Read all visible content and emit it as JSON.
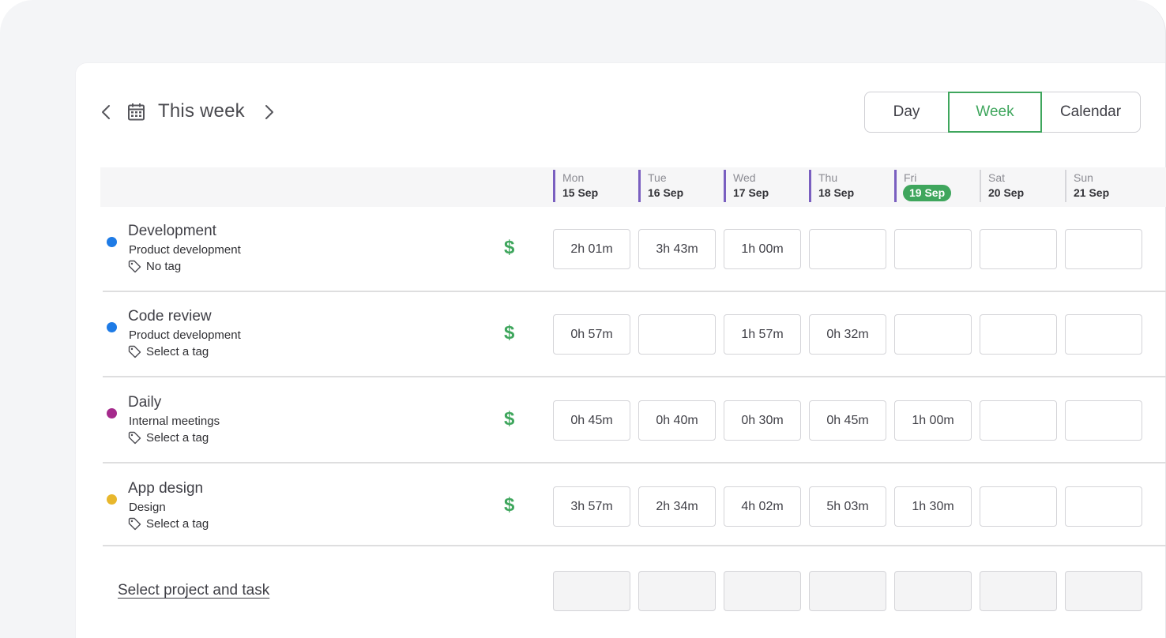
{
  "header": {
    "period_title": "This week",
    "prev_icon": "chevron-left-icon",
    "next_icon": "chevron-right-icon",
    "calendar_icon": "calendar-icon"
  },
  "view_switch": {
    "options": [
      "Day",
      "Week",
      "Calendar"
    ],
    "selected": "Week"
  },
  "days": [
    {
      "name": "Mon",
      "date": "15 Sep"
    },
    {
      "name": "Tue",
      "date": "16 Sep"
    },
    {
      "name": "Wed",
      "date": "17 Sep"
    },
    {
      "name": "Thu",
      "date": "18 Sep"
    },
    {
      "name": "Fri",
      "date": "19 Sep"
    },
    {
      "name": "Sat",
      "date": "20 Sep"
    },
    {
      "name": "Sun",
      "date": "21 Sep"
    }
  ],
  "today_index": 4,
  "rows": [
    {
      "project": "Development",
      "subtitle": "Product development",
      "tag": "No tag",
      "color": "#1e7be6",
      "billable": "$",
      "times": [
        "2h 01m",
        "3h 43m",
        "1h 00m",
        "",
        "",
        "",
        ""
      ]
    },
    {
      "project": "Code review",
      "subtitle": "Product development",
      "tag": "Select a tag",
      "color": "#1e7be6",
      "billable": "$",
      "times": [
        "0h 57m",
        "",
        "1h 57m",
        "0h 32m",
        "",
        "",
        ""
      ]
    },
    {
      "project": "Daily",
      "subtitle": "Internal meetings",
      "tag": "Select a tag",
      "color": "#a52a8c",
      "billable": "$",
      "times": [
        "0h 45m",
        "0h 40m",
        "0h 30m",
        "0h 45m",
        "1h 00m",
        "",
        ""
      ]
    },
    {
      "project": "App design",
      "subtitle": "Design",
      "tag": "Select a tag",
      "color": "#e8b72c",
      "billable": "$",
      "times": [
        "3h 57m",
        "2h 34m",
        "4h 02m",
        "5h 03m",
        "1h 30m",
        "",
        ""
      ]
    }
  ],
  "new_row": {
    "link": "Select project and task"
  },
  "colors": {
    "accent": "#3fa65d",
    "past_day_marker": "#7a5fc0"
  }
}
